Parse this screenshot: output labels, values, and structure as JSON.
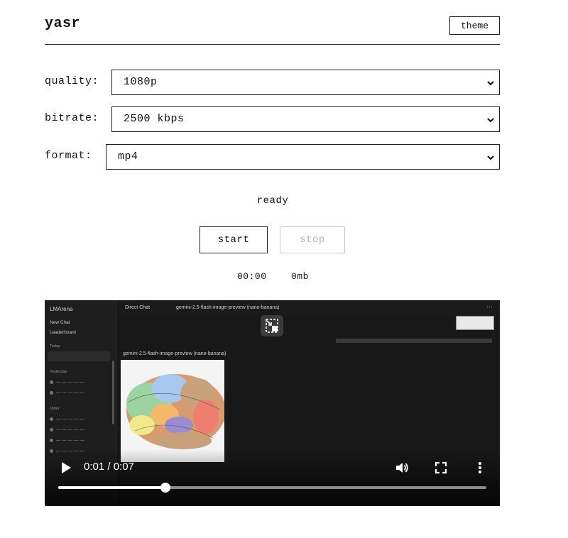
{
  "app": {
    "title": "yasr",
    "theme_label": "theme"
  },
  "settings": {
    "quality": {
      "label": "quality:",
      "value": "1080p"
    },
    "bitrate": {
      "label": "bitrate:",
      "value": "2500 kbps"
    },
    "format": {
      "label": "format:",
      "value": "mp4"
    }
  },
  "status": "ready",
  "controls": {
    "start_label": "start",
    "stop_label": "stop"
  },
  "recording": {
    "timer": "00:00",
    "size": "0mb"
  },
  "video": {
    "current_time": "0:01",
    "duration": "0:07",
    "time_display": "0:01 / 0:07",
    "progress_fraction": 0.25,
    "embedded": {
      "brand": "LMArena",
      "sidebar_items": [
        "New Chat",
        "Leaderboard"
      ],
      "sidebar_sections": [
        "Today",
        "Yesterday",
        "Older"
      ],
      "mode": "Direct Chat",
      "model": "gemini-2.5-flash-image-preview (nano-banana)",
      "model_label": "gemini-2.5-flash-image-preview (nano-banana)"
    },
    "icons": [
      "play-icon",
      "volume-icon",
      "fullscreen-icon",
      "more-vert-icon",
      "picture-in-picture-icon"
    ]
  },
  "colors": {
    "border": "#222222",
    "disabled": "#b5b5b5",
    "video_bg": "#181818"
  }
}
